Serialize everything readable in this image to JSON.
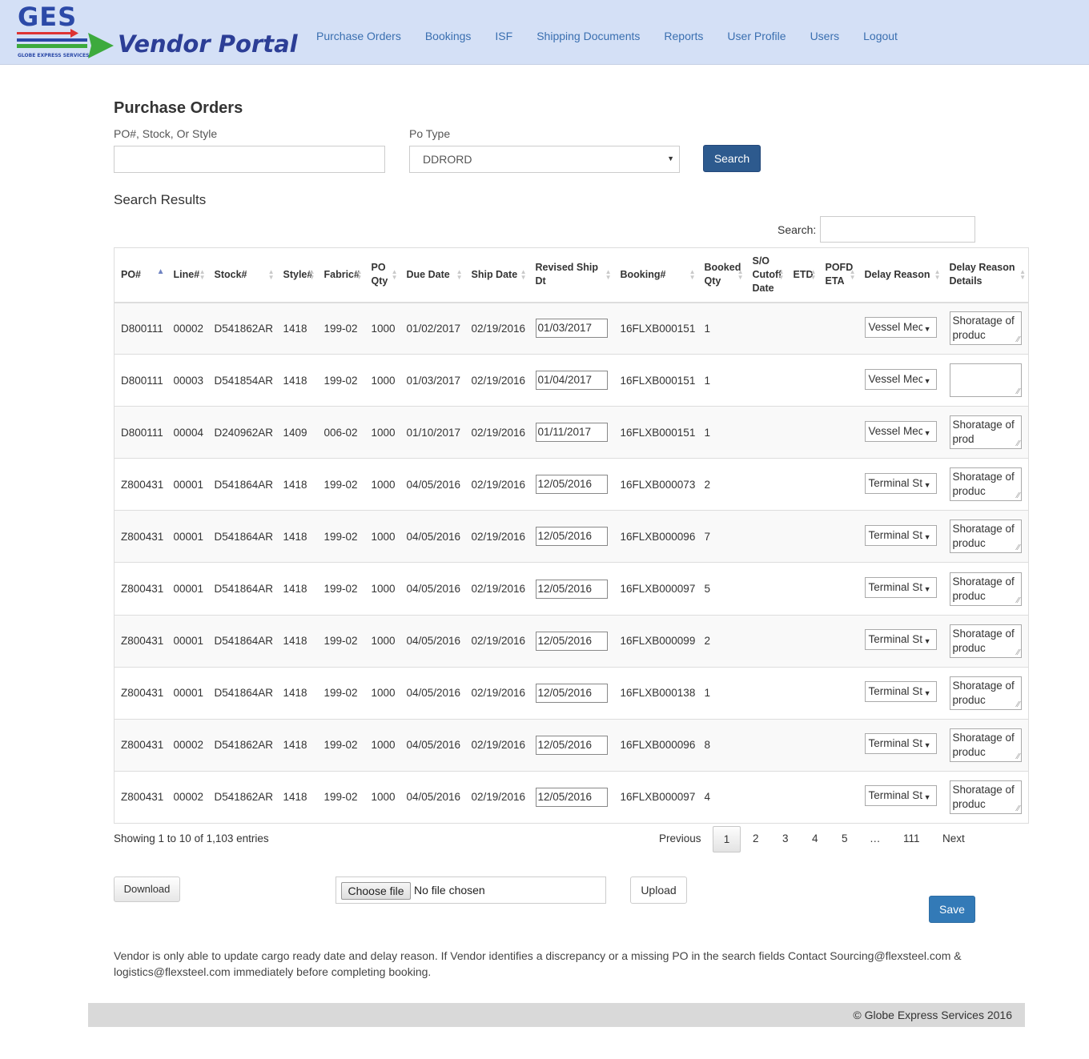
{
  "brand": {
    "logo_text": "GES",
    "logo_subtext": "GLOBE EXPRESS SERVICES",
    "title": "Vendor Portal",
    "colors": {
      "header_bg": "#d4e0f6",
      "brand_blue": "#2c4aa8",
      "arrow_green": "#3daa3d",
      "arrow_red": "#d33"
    }
  },
  "nav": [
    "Purchase Orders",
    "Bookings",
    "ISF",
    "Shipping Documents",
    "Reports",
    "User Profile",
    "Users",
    "Logout"
  ],
  "page": {
    "title": "Purchase Orders",
    "search_label": "PO#, Stock, Or Style",
    "search_value": "",
    "po_type_label": "Po Type",
    "po_type_value": "DDRORD",
    "search_button": "Search",
    "results_title": "Search Results",
    "table_search_label": "Search:",
    "table_search_value": ""
  },
  "table": {
    "columns": [
      "PO#",
      "Line#",
      "Stock#",
      "Style#",
      "Fabric#",
      "PO Qty",
      "Due Date",
      "Ship Date",
      "Revised Ship Dt",
      "Booking#",
      "Booked Qty",
      "S/O Cutoff Date",
      "ETD",
      "POFD ETA",
      "Delay Reason",
      "Delay Reason Details"
    ],
    "rows": [
      {
        "po": "D800111",
        "line": "00002",
        "stock": "D541862AR",
        "style": "1418",
        "fabric": "199-02",
        "qty": "1000",
        "due": "01/02/2017",
        "ship": "02/19/2016",
        "revised": "01/03/2017",
        "booking": "16FLXB000151",
        "booked": "1",
        "cutoff": "",
        "etd": "",
        "pofd": "",
        "reason": "Vessel Mec",
        "details": "Shoratage of produc"
      },
      {
        "po": "D800111",
        "line": "00003",
        "stock": "D541854AR",
        "style": "1418",
        "fabric": "199-02",
        "qty": "1000",
        "due": "01/03/2017",
        "ship": "02/19/2016",
        "revised": "01/04/2017",
        "booking": "16FLXB000151",
        "booked": "1",
        "cutoff": "",
        "etd": "",
        "pofd": "",
        "reason": "Vessel Mec",
        "details": ""
      },
      {
        "po": "D800111",
        "line": "00004",
        "stock": "D240962AR",
        "style": "1409",
        "fabric": "006-02",
        "qty": "1000",
        "due": "01/10/2017",
        "ship": "02/19/2016",
        "revised": "01/11/2017",
        "booking": "16FLXB000151",
        "booked": "1",
        "cutoff": "",
        "etd": "",
        "pofd": "",
        "reason": "Vessel Mec",
        "details": "Shoratage of prod"
      },
      {
        "po": "Z800431",
        "line": "00001",
        "stock": "D541864AR",
        "style": "1418",
        "fabric": "199-02",
        "qty": "1000",
        "due": "04/05/2016",
        "ship": "02/19/2016",
        "revised": "12/05/2016",
        "booking": "16FLXB000073",
        "booked": "2",
        "cutoff": "",
        "etd": "",
        "pofd": "",
        "reason": "Terminal St",
        "details": "Shoratage of produc"
      },
      {
        "po": "Z800431",
        "line": "00001",
        "stock": "D541864AR",
        "style": "1418",
        "fabric": "199-02",
        "qty": "1000",
        "due": "04/05/2016",
        "ship": "02/19/2016",
        "revised": "12/05/2016",
        "booking": "16FLXB000096",
        "booked": "7",
        "cutoff": "",
        "etd": "",
        "pofd": "",
        "reason": "Terminal St",
        "details": "Shoratage of produc"
      },
      {
        "po": "Z800431",
        "line": "00001",
        "stock": "D541864AR",
        "style": "1418",
        "fabric": "199-02",
        "qty": "1000",
        "due": "04/05/2016",
        "ship": "02/19/2016",
        "revised": "12/05/2016",
        "booking": "16FLXB000097",
        "booked": "5",
        "cutoff": "",
        "etd": "",
        "pofd": "",
        "reason": "Terminal St",
        "details": "Shoratage of produc"
      },
      {
        "po": "Z800431",
        "line": "00001",
        "stock": "D541864AR",
        "style": "1418",
        "fabric": "199-02",
        "qty": "1000",
        "due": "04/05/2016",
        "ship": "02/19/2016",
        "revised": "12/05/2016",
        "booking": "16FLXB000099",
        "booked": "2",
        "cutoff": "",
        "etd": "",
        "pofd": "",
        "reason": "Terminal St",
        "details": "Shoratage of produc"
      },
      {
        "po": "Z800431",
        "line": "00001",
        "stock": "D541864AR",
        "style": "1418",
        "fabric": "199-02",
        "qty": "1000",
        "due": "04/05/2016",
        "ship": "02/19/2016",
        "revised": "12/05/2016",
        "booking": "16FLXB000138",
        "booked": "1",
        "cutoff": "",
        "etd": "",
        "pofd": "",
        "reason": "Terminal St",
        "details": "Shoratage of produc"
      },
      {
        "po": "Z800431",
        "line": "00002",
        "stock": "D541862AR",
        "style": "1418",
        "fabric": "199-02",
        "qty": "1000",
        "due": "04/05/2016",
        "ship": "02/19/2016",
        "revised": "12/05/2016",
        "booking": "16FLXB000096",
        "booked": "8",
        "cutoff": "",
        "etd": "",
        "pofd": "",
        "reason": "Terminal St",
        "details": "Shoratage of produc"
      },
      {
        "po": "Z800431",
        "line": "00002",
        "stock": "D541862AR",
        "style": "1418",
        "fabric": "199-02",
        "qty": "1000",
        "due": "04/05/2016",
        "ship": "02/19/2016",
        "revised": "12/05/2016",
        "booking": "16FLXB000097",
        "booked": "4",
        "cutoff": "",
        "etd": "",
        "pofd": "",
        "reason": "Terminal St",
        "details": "Shoratage of produc"
      }
    ]
  },
  "pagination": {
    "info": "Showing 1 to 10 of 1,103 entries",
    "previous": "Previous",
    "pages": [
      "1",
      "2",
      "3",
      "4",
      "5",
      "…",
      "111"
    ],
    "current": "1",
    "next": "Next"
  },
  "actions": {
    "download": "Download",
    "choose_file": "Choose file",
    "file_status": "No file chosen",
    "upload": "Upload",
    "save": "Save"
  },
  "notice": "Vendor is only able to update cargo ready date and delay reason. If Vendor identifies a discrepancy or a missing PO in the search fields Contact Sourcing@flexsteel.com & logistics@flexsteel.com immediately before completing booking.",
  "footer": "© Globe Express Services 2016"
}
